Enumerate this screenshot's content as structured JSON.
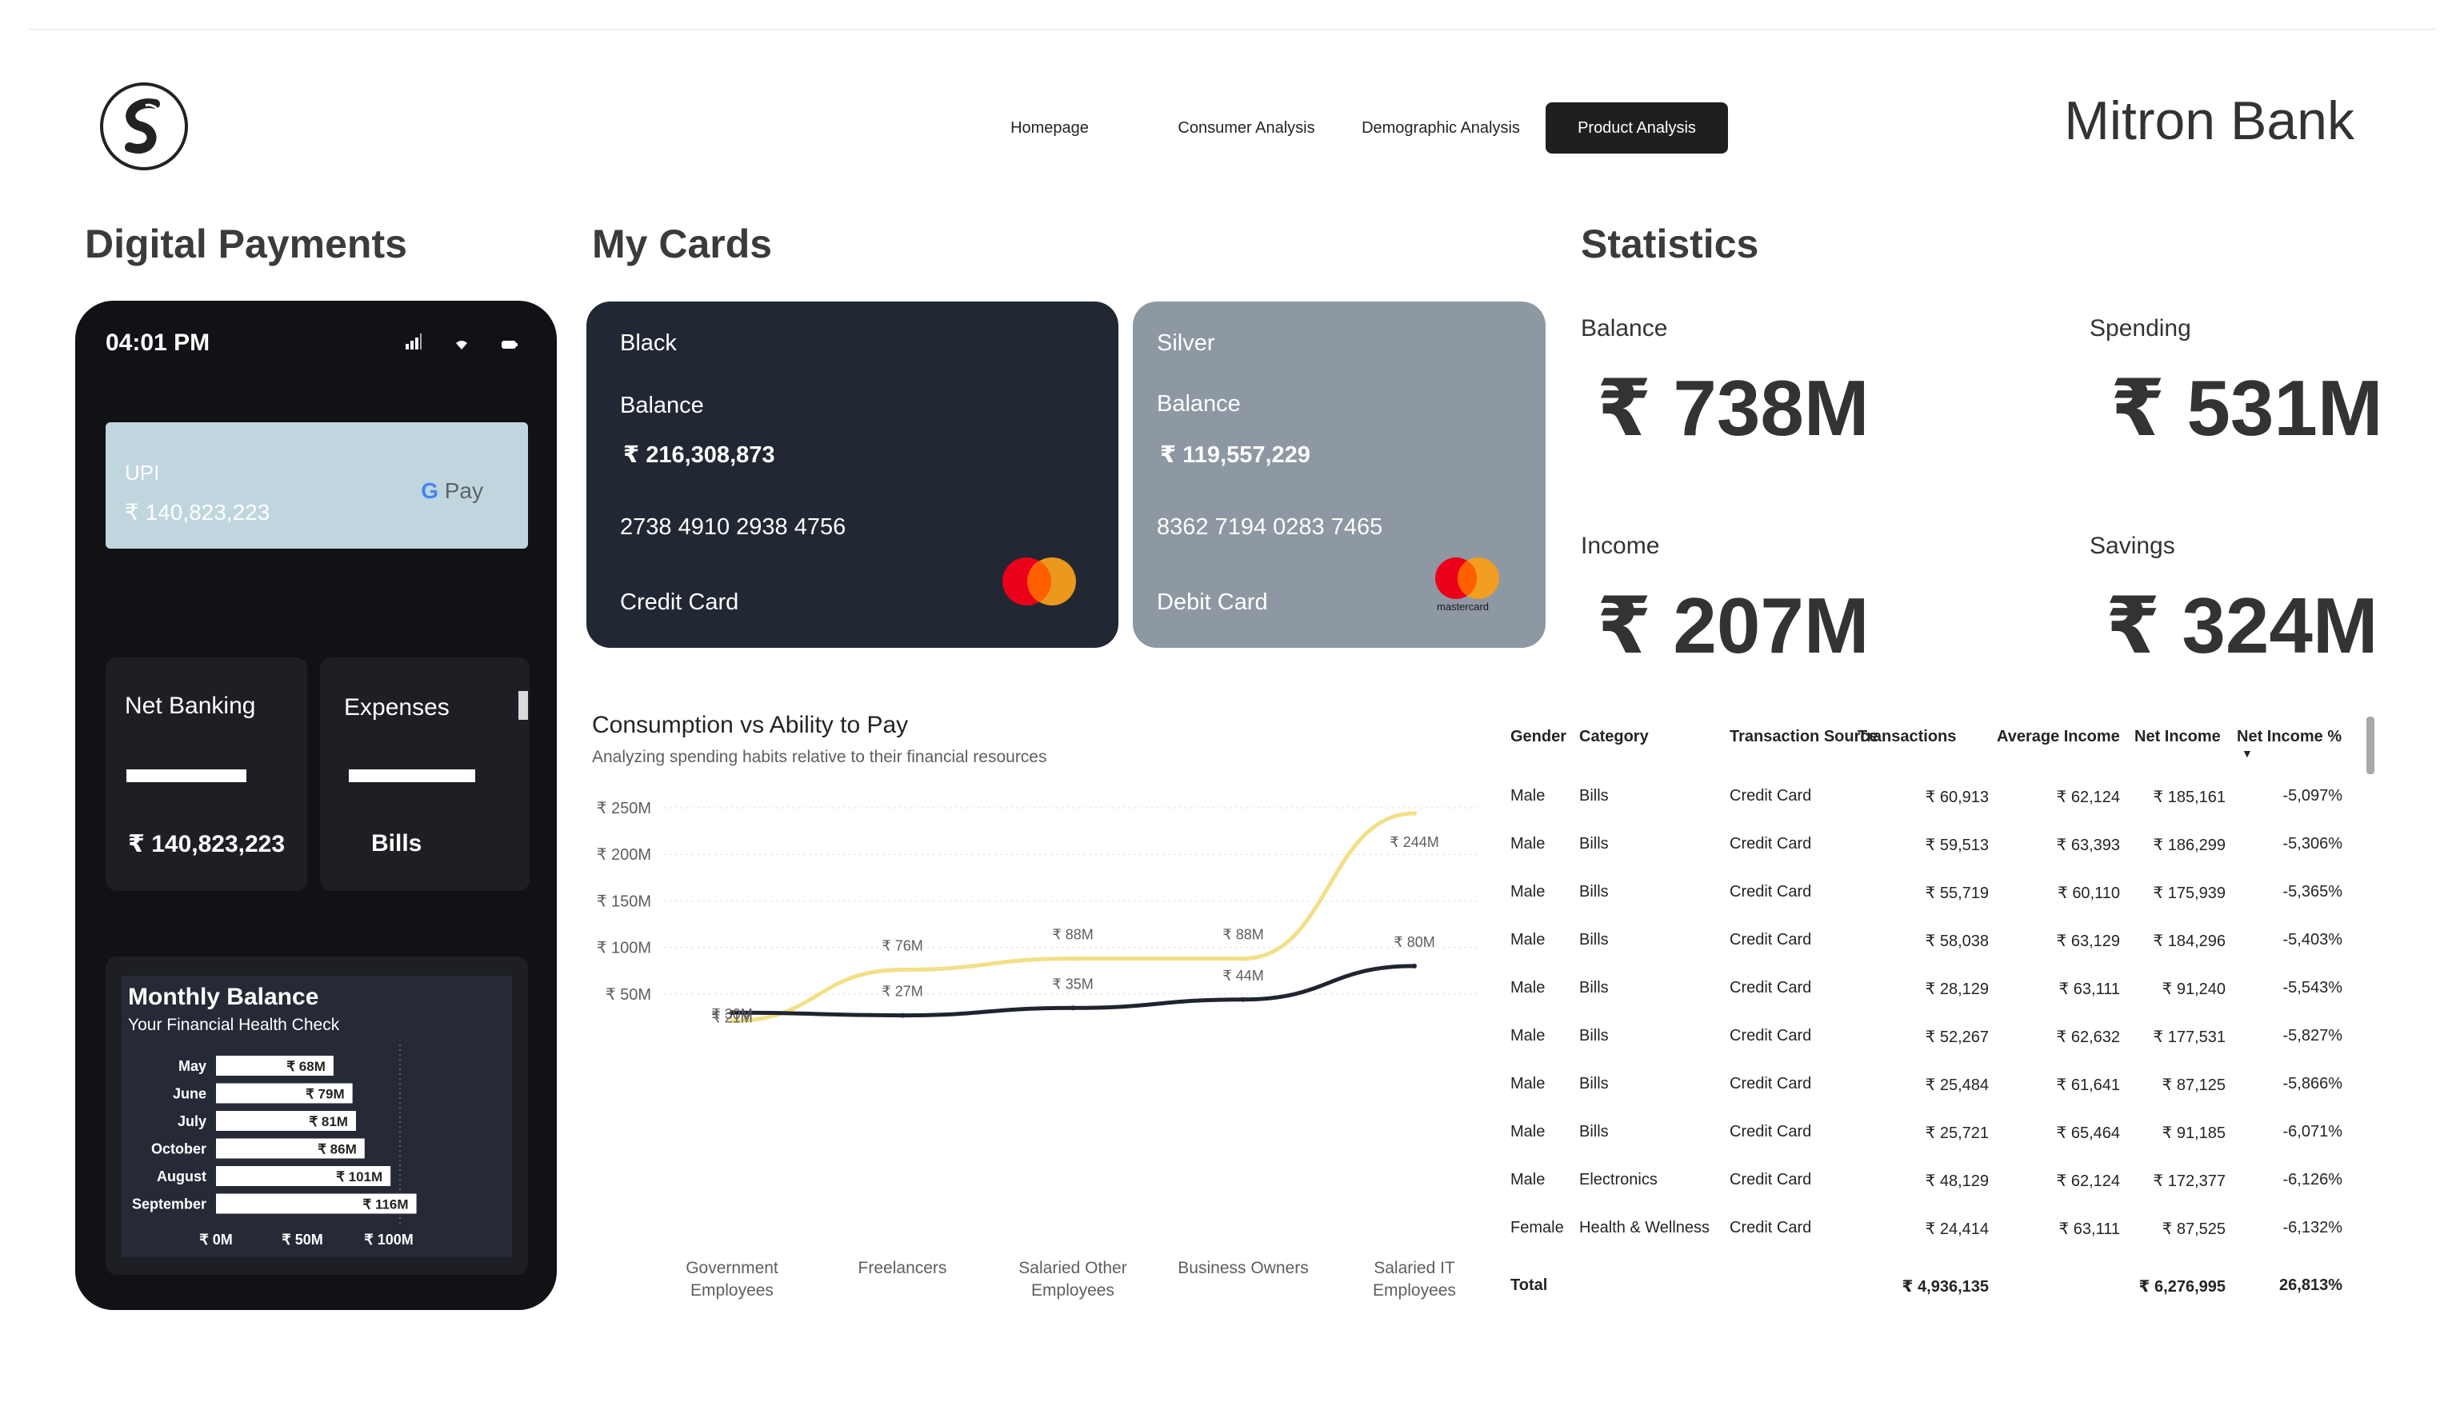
{
  "brand": "Mitron Bank",
  "nav": [
    {
      "label": "Homepage",
      "active": false
    },
    {
      "label": "Consumer Analysis",
      "active": false
    },
    {
      "label": "Demographic Analysis",
      "active": false
    },
    {
      "label": "Product Analysis",
      "active": true
    }
  ],
  "sections": {
    "digital_payments": "Digital Payments",
    "my_cards": "My Cards",
    "statistics": "Statistics"
  },
  "phone": {
    "time": "04:01 PM",
    "upi": {
      "label": "UPI",
      "value": "₹ 140,823,223",
      "gpay": "Pay"
    },
    "net_banking": {
      "title": "Net Banking",
      "value": "₹ 140,823,223"
    },
    "expenses": {
      "title": "Expenses",
      "value": "Bills"
    }
  },
  "monthly_balance": {
    "title": "Monthly Balance",
    "subtitle": "Your Financial Health Check",
    "chart_data": {
      "type": "bar",
      "orientation": "horizontal",
      "categories": [
        "May",
        "June",
        "July",
        "October",
        "August",
        "September"
      ],
      "values": [
        68,
        79,
        81,
        86,
        101,
        116
      ],
      "value_labels": [
        "₹ 68M",
        "₹ 79M",
        "₹ 81M",
        "₹ 86M",
        "₹ 101M",
        "₹ 116M"
      ],
      "x_ticks": [
        "₹ 0M",
        "₹ 50M",
        "₹ 100M"
      ],
      "xlim": [
        0,
        125
      ]
    }
  },
  "cards": [
    {
      "tier": "Black",
      "balance_label": "Balance",
      "balance": "₹ 216,308,873",
      "number": "2738 4910 2938 4756",
      "type": "Credit Card",
      "mc_text": ""
    },
    {
      "tier": "Silver",
      "balance_label": "Balance",
      "balance": "₹ 119,557,229",
      "number": "8362 7194 0283 7465",
      "type": "Debit Card",
      "mc_text": "mastercard"
    }
  ],
  "stats": [
    {
      "label": "Balance",
      "value": "₹ 738M"
    },
    {
      "label": "Spending",
      "value": "₹ 531M"
    },
    {
      "label": "Income",
      "value": "₹ 207M"
    },
    {
      "label": "Savings",
      "value": "₹ 324M"
    }
  ],
  "consumption_chart": {
    "title": "Consumption vs Ability to Pay",
    "subtitle": "Analyzing spending habits relative to their financial resources",
    "chart_data": {
      "type": "line",
      "categories": [
        "Government Employees",
        "Freelancers",
        "Salaried Other Employees",
        "Business Owners",
        "Salaried IT Employees"
      ],
      "y_ticks": [
        "₹ 50M",
        "₹ 100M",
        "₹ 150M",
        "₹ 200M",
        "₹ 250M"
      ],
      "ylim": [
        20,
        250
      ],
      "series": [
        {
          "values": [
            21,
            76,
            88,
            88,
            244
          ],
          "labels": [
            "₹ 21M",
            "₹ 76M",
            "₹ 88M",
            "₹ 88M",
            "₹ 244M"
          ],
          "color": "#f2df87"
        },
        {
          "values": [
            30,
            27,
            35,
            44,
            80
          ],
          "labels": [
            "₹ 30M",
            "₹ 27M",
            "₹ 35M",
            "₹ 44M",
            "₹ 80M"
          ],
          "color": "#1f2430"
        }
      ],
      "grid": true
    }
  },
  "table": {
    "columns": [
      "Gender",
      "Category",
      "Transaction Source",
      "Transactions",
      "Average Income",
      "Net Income",
      "Net Income %"
    ],
    "rows": [
      [
        "Male",
        "Bills",
        "Credit Card",
        "₹ 60,913",
        "₹ 62,124",
        "₹ 185,161",
        "-5,097%"
      ],
      [
        "Male",
        "Bills",
        "Credit Card",
        "₹ 59,513",
        "₹ 63,393",
        "₹ 186,299",
        "-5,306%"
      ],
      [
        "Male",
        "Bills",
        "Credit Card",
        "₹ 55,719",
        "₹ 60,110",
        "₹ 175,939",
        "-5,365%"
      ],
      [
        "Male",
        "Bills",
        "Credit Card",
        "₹ 58,038",
        "₹ 63,129",
        "₹ 184,296",
        "-5,403%"
      ],
      [
        "Male",
        "Bills",
        "Credit Card",
        "₹ 28,129",
        "₹ 63,111",
        "₹ 91,240",
        "-5,543%"
      ],
      [
        "Male",
        "Bills",
        "Credit Card",
        "₹ 52,267",
        "₹ 62,632",
        "₹ 177,531",
        "-5,827%"
      ],
      [
        "Male",
        "Bills",
        "Credit Card",
        "₹ 25,484",
        "₹ 61,641",
        "₹ 87,125",
        "-5,866%"
      ],
      [
        "Male",
        "Bills",
        "Credit Card",
        "₹ 25,721",
        "₹ 65,464",
        "₹ 91,185",
        "-6,071%"
      ],
      [
        "Male",
        "Electronics",
        "Credit Card",
        "₹ 48,129",
        "₹ 62,124",
        "₹ 172,377",
        "-6,126%"
      ],
      [
        "Female",
        "Health & Wellness",
        "Credit Card",
        "₹ 24,414",
        "₹ 63,111",
        "₹ 87,525",
        "-6,132%"
      ]
    ],
    "total": {
      "label": "Total",
      "transactions": "₹ 4,936,135",
      "net_income": "₹ 6,276,995",
      "net_income_pct": "26,813%"
    }
  }
}
